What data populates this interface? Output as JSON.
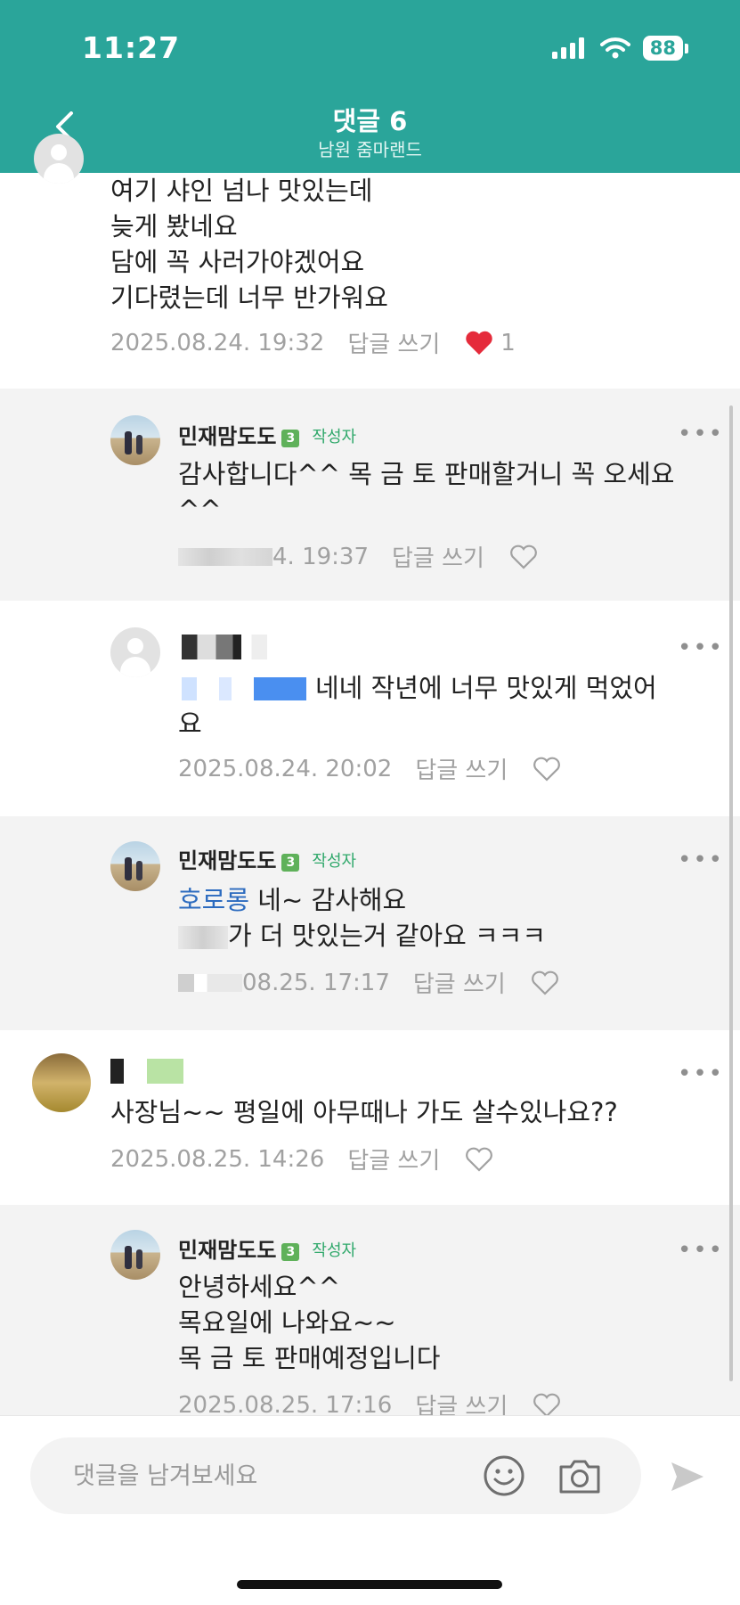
{
  "status_bar": {
    "time": "11:27",
    "battery": "88"
  },
  "nav": {
    "title": "댓글 6",
    "subtitle": "남원 줌마랜드"
  },
  "comments": [
    {
      "lines": [
        "여기 샤인 넘나 맛있는데",
        "늦게 봤네요",
        "담에 꼭 사러가야겠어요",
        "기다렸는데 너무 반가워요"
      ],
      "date": "2025.08.24. 19:32",
      "reply_label": "답글 쓰기",
      "like_count": "1"
    },
    {
      "name": "민재맘도도",
      "level": "3",
      "author_badge": "작성자",
      "lines": [
        "감사합니다^^ 목 금 토 판매할거니 꼭 오세요",
        "^^"
      ],
      "date": "4. 19:37",
      "reply_label": "답글 쓰기"
    },
    {
      "lines": [
        "네네 작년에 너무 맛있게 먹었어",
        "요"
      ],
      "date": "2025.08.24. 20:02",
      "reply_label": "답글 쓰기"
    },
    {
      "name": "민재맘도도",
      "level": "3",
      "author_badge": "작성자",
      "mention": "호로롱",
      "lines": [
        "네~ 감사해요",
        "가 더 맛있는거 같아요 ㅋㅋㅋ"
      ],
      "date": "08.25. 17:17",
      "reply_label": "답글 쓰기"
    },
    {
      "lines": [
        "사장님~~ 평일에 아무때나 가도 살수있나요??"
      ],
      "date": "2025.08.25. 14:26",
      "reply_label": "답글 쓰기"
    },
    {
      "name": "민재맘도도",
      "level": "3",
      "author_badge": "작성자",
      "lines": [
        "안녕하세요^^",
        "목요일에 나와요~~",
        "목 금 토 판매예정입니다"
      ],
      "date": "2025.08.25. 17:16",
      "reply_label": "답글 쓰기"
    }
  ],
  "composer": {
    "placeholder": "댓글을 남겨보세요"
  },
  "colors": {
    "header": "#2aa59a",
    "heart": "#e52b3b",
    "mention": "#2c6bbf",
    "author_badge": "#2fa86a"
  }
}
